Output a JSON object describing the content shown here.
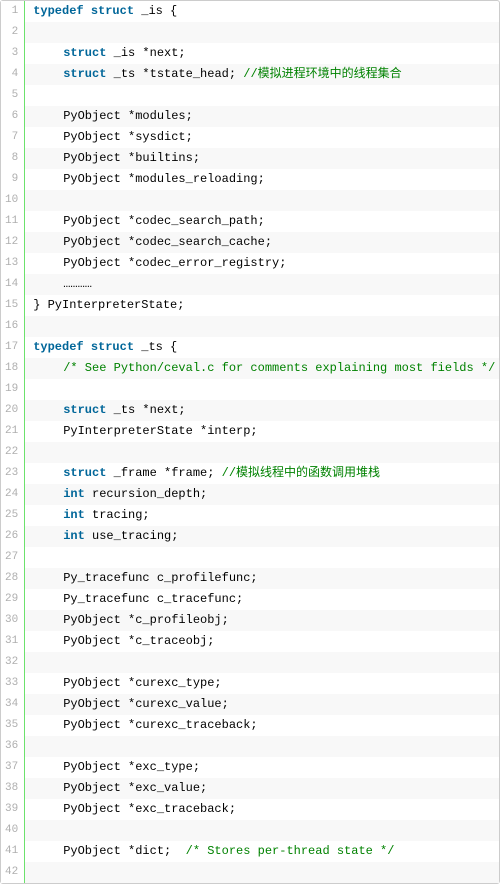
{
  "lines": [
    {
      "n": 1,
      "tokens": [
        {
          "t": "typedef",
          "c": "kw"
        },
        {
          "t": " "
        },
        {
          "t": "struct",
          "c": "kw"
        },
        {
          "t": " _is {"
        }
      ]
    },
    {
      "n": 2,
      "tokens": []
    },
    {
      "n": 3,
      "indent": 1,
      "tokens": [
        {
          "t": "struct",
          "c": "kw"
        },
        {
          "t": " _is *next;"
        }
      ]
    },
    {
      "n": 4,
      "indent": 1,
      "tokens": [
        {
          "t": "struct",
          "c": "kw"
        },
        {
          "t": " _ts *tstate_head; "
        },
        {
          "t": "//模拟进程环境中的线程集合",
          "c": "cm"
        }
      ]
    },
    {
      "n": 5,
      "tokens": []
    },
    {
      "n": 6,
      "indent": 1,
      "tokens": [
        {
          "t": "PyObject *modules;"
        }
      ]
    },
    {
      "n": 7,
      "indent": 1,
      "tokens": [
        {
          "t": "PyObject *sysdict;"
        }
      ]
    },
    {
      "n": 8,
      "indent": 1,
      "tokens": [
        {
          "t": "PyObject *builtins;"
        }
      ]
    },
    {
      "n": 9,
      "indent": 1,
      "tokens": [
        {
          "t": "PyObject *modules_reloading;"
        }
      ]
    },
    {
      "n": 10,
      "tokens": []
    },
    {
      "n": 11,
      "indent": 1,
      "tokens": [
        {
          "t": "PyObject *codec_search_path;"
        }
      ]
    },
    {
      "n": 12,
      "indent": 1,
      "tokens": [
        {
          "t": "PyObject *codec_search_cache;"
        }
      ]
    },
    {
      "n": 13,
      "indent": 1,
      "tokens": [
        {
          "t": "PyObject *codec_error_registry;"
        }
      ]
    },
    {
      "n": 14,
      "indent": 1,
      "tokens": [
        {
          "t": "…………"
        }
      ]
    },
    {
      "n": 15,
      "tokens": [
        {
          "t": "} PyInterpreterState;"
        }
      ]
    },
    {
      "n": 16,
      "tokens": []
    },
    {
      "n": 17,
      "tokens": [
        {
          "t": "typedef",
          "c": "kw"
        },
        {
          "t": " "
        },
        {
          "t": "struct",
          "c": "kw"
        },
        {
          "t": " _ts {"
        }
      ]
    },
    {
      "n": 18,
      "indent": 1,
      "tokens": [
        {
          "t": "/* See Python/ceval.c for comments explaining most fields */",
          "c": "cm"
        }
      ]
    },
    {
      "n": 19,
      "tokens": []
    },
    {
      "n": 20,
      "indent": 1,
      "tokens": [
        {
          "t": "struct",
          "c": "kw"
        },
        {
          "t": " _ts *next;"
        }
      ]
    },
    {
      "n": 21,
      "indent": 1,
      "tokens": [
        {
          "t": "PyInterpreterState *interp;"
        }
      ]
    },
    {
      "n": 22,
      "tokens": []
    },
    {
      "n": 23,
      "indent": 1,
      "tokens": [
        {
          "t": "struct",
          "c": "kw"
        },
        {
          "t": " _frame *frame; "
        },
        {
          "t": "//模拟线程中的函数调用堆栈",
          "c": "cm"
        }
      ]
    },
    {
      "n": 24,
      "indent": 1,
      "tokens": [
        {
          "t": "int",
          "c": "kw"
        },
        {
          "t": " recursion_depth;"
        }
      ]
    },
    {
      "n": 25,
      "indent": 1,
      "tokens": [
        {
          "t": "int",
          "c": "kw"
        },
        {
          "t": " tracing;"
        }
      ]
    },
    {
      "n": 26,
      "indent": 1,
      "tokens": [
        {
          "t": "int",
          "c": "kw"
        },
        {
          "t": " use_tracing;"
        }
      ]
    },
    {
      "n": 27,
      "tokens": []
    },
    {
      "n": 28,
      "indent": 1,
      "tokens": [
        {
          "t": "Py_tracefunc c_profilefunc;"
        }
      ]
    },
    {
      "n": 29,
      "indent": 1,
      "tokens": [
        {
          "t": "Py_tracefunc c_tracefunc;"
        }
      ]
    },
    {
      "n": 30,
      "indent": 1,
      "tokens": [
        {
          "t": "PyObject *c_profileobj;"
        }
      ]
    },
    {
      "n": 31,
      "indent": 1,
      "tokens": [
        {
          "t": "PyObject *c_traceobj;"
        }
      ]
    },
    {
      "n": 32,
      "tokens": []
    },
    {
      "n": 33,
      "indent": 1,
      "tokens": [
        {
          "t": "PyObject *curexc_type;"
        }
      ]
    },
    {
      "n": 34,
      "indent": 1,
      "tokens": [
        {
          "t": "PyObject *curexc_value;"
        }
      ]
    },
    {
      "n": 35,
      "indent": 1,
      "tokens": [
        {
          "t": "PyObject *curexc_traceback;"
        }
      ]
    },
    {
      "n": 36,
      "tokens": []
    },
    {
      "n": 37,
      "indent": 1,
      "tokens": [
        {
          "t": "PyObject *exc_type;"
        }
      ]
    },
    {
      "n": 38,
      "indent": 1,
      "tokens": [
        {
          "t": "PyObject *exc_value;"
        }
      ]
    },
    {
      "n": 39,
      "indent": 1,
      "tokens": [
        {
          "t": "PyObject *exc_traceback;"
        }
      ]
    },
    {
      "n": 40,
      "tokens": []
    },
    {
      "n": 41,
      "indent": 1,
      "tokens": [
        {
          "t": "PyObject *dict;  "
        },
        {
          "t": "/* Stores per-thread state */",
          "c": "cm"
        }
      ]
    },
    {
      "n": 42,
      "tokens": []
    }
  ]
}
